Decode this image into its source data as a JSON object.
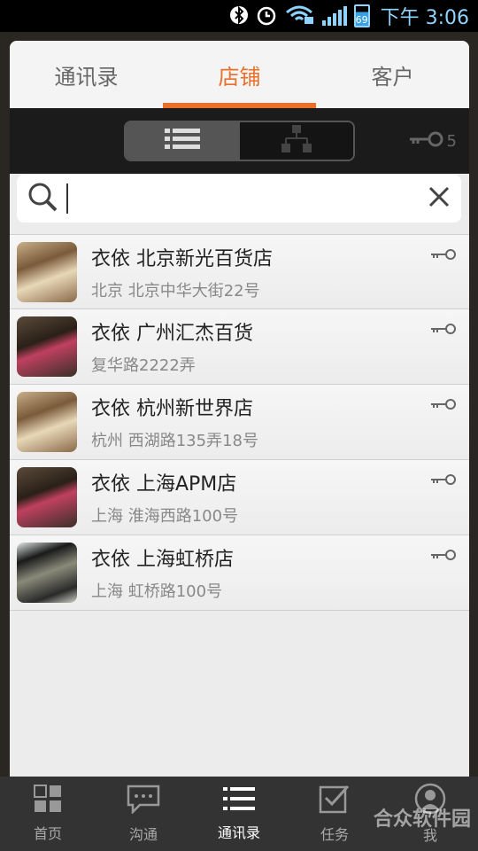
{
  "status": {
    "time": "下午 3:06",
    "battery": "69"
  },
  "tabs": [
    {
      "label": "通讯录"
    },
    {
      "label": "店铺"
    },
    {
      "label": "客户"
    }
  ],
  "toolbar": {
    "key_count": "5"
  },
  "search": {
    "value": "",
    "placeholder": ""
  },
  "stores": [
    {
      "name": "衣依 北京新光百货店",
      "address": "北京 北京中华大街22号"
    },
    {
      "name": "衣依 广州汇杰百货",
      "address": "复华路2222弄"
    },
    {
      "name": "衣依 杭州新世界店",
      "address": "杭州 西湖路135弄18号"
    },
    {
      "name": "衣依 上海APM店",
      "address": "上海 淮海西路100号"
    },
    {
      "name": "衣依 上海虹桥店",
      "address": "上海 虹桥路100号"
    }
  ],
  "bottom_nav": [
    {
      "label": "首页",
      "icon": "home-grid-icon"
    },
    {
      "label": "沟通",
      "icon": "chat-bubble-icon"
    },
    {
      "label": "通讯录",
      "icon": "list-icon"
    },
    {
      "label": "任务",
      "icon": "checkbox-icon"
    },
    {
      "label": "我",
      "icon": "person-icon"
    }
  ],
  "watermark": "合众软件园",
  "colors": {
    "accent": "#e8702a",
    "status_blue": "#8fd3ff"
  }
}
